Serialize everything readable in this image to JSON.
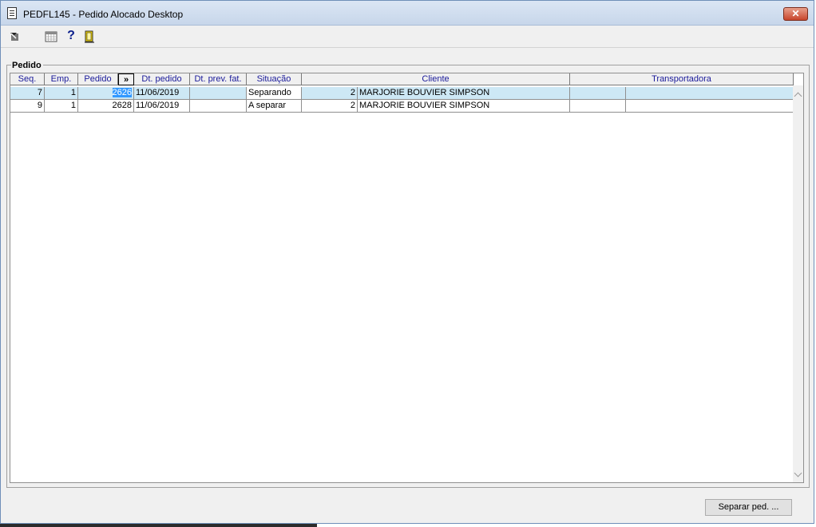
{
  "window": {
    "title": "PEDFL145 - Pedido Alocado Desktop",
    "close_label": "✕"
  },
  "toolbar": {
    "icons": [
      "arrow-icon",
      "calendar-icon",
      "help-icon",
      "exit-icon"
    ],
    "help_glyph": "?"
  },
  "section": {
    "label": "Pedido"
  },
  "grid": {
    "columns": [
      "Seq.",
      "Emp.",
      "Pedido",
      "»",
      "Dt. pedido",
      "Dt. prev. fat.",
      "Situação",
      "Cliente",
      "Transportadora"
    ],
    "rows": [
      {
        "seq": "7",
        "emp": "1",
        "pedido": "2626",
        "dt_pedido": "11/06/2019",
        "dt_prev_fat": "",
        "situacao": "Separando",
        "cliente_cod": "2",
        "cliente_nome": "MARJORIE BOUVIER SIMPSON",
        "transp_cod": "",
        "transp_nome": ""
      },
      {
        "seq": "9",
        "emp": "1",
        "pedido": "2628",
        "dt_pedido": "11/06/2019",
        "dt_prev_fat": "",
        "situacao": "A separar",
        "cliente_cod": "2",
        "cliente_nome": "MARJORIE BOUVIER SIMPSON",
        "transp_cod": "",
        "transp_nome": ""
      }
    ]
  },
  "footer": {
    "separar_label": "Separar ped. ..."
  },
  "colors": {
    "selected_row": "#cde8f5",
    "header_text": "#1a1a9a",
    "highlight": "#3399ff"
  }
}
